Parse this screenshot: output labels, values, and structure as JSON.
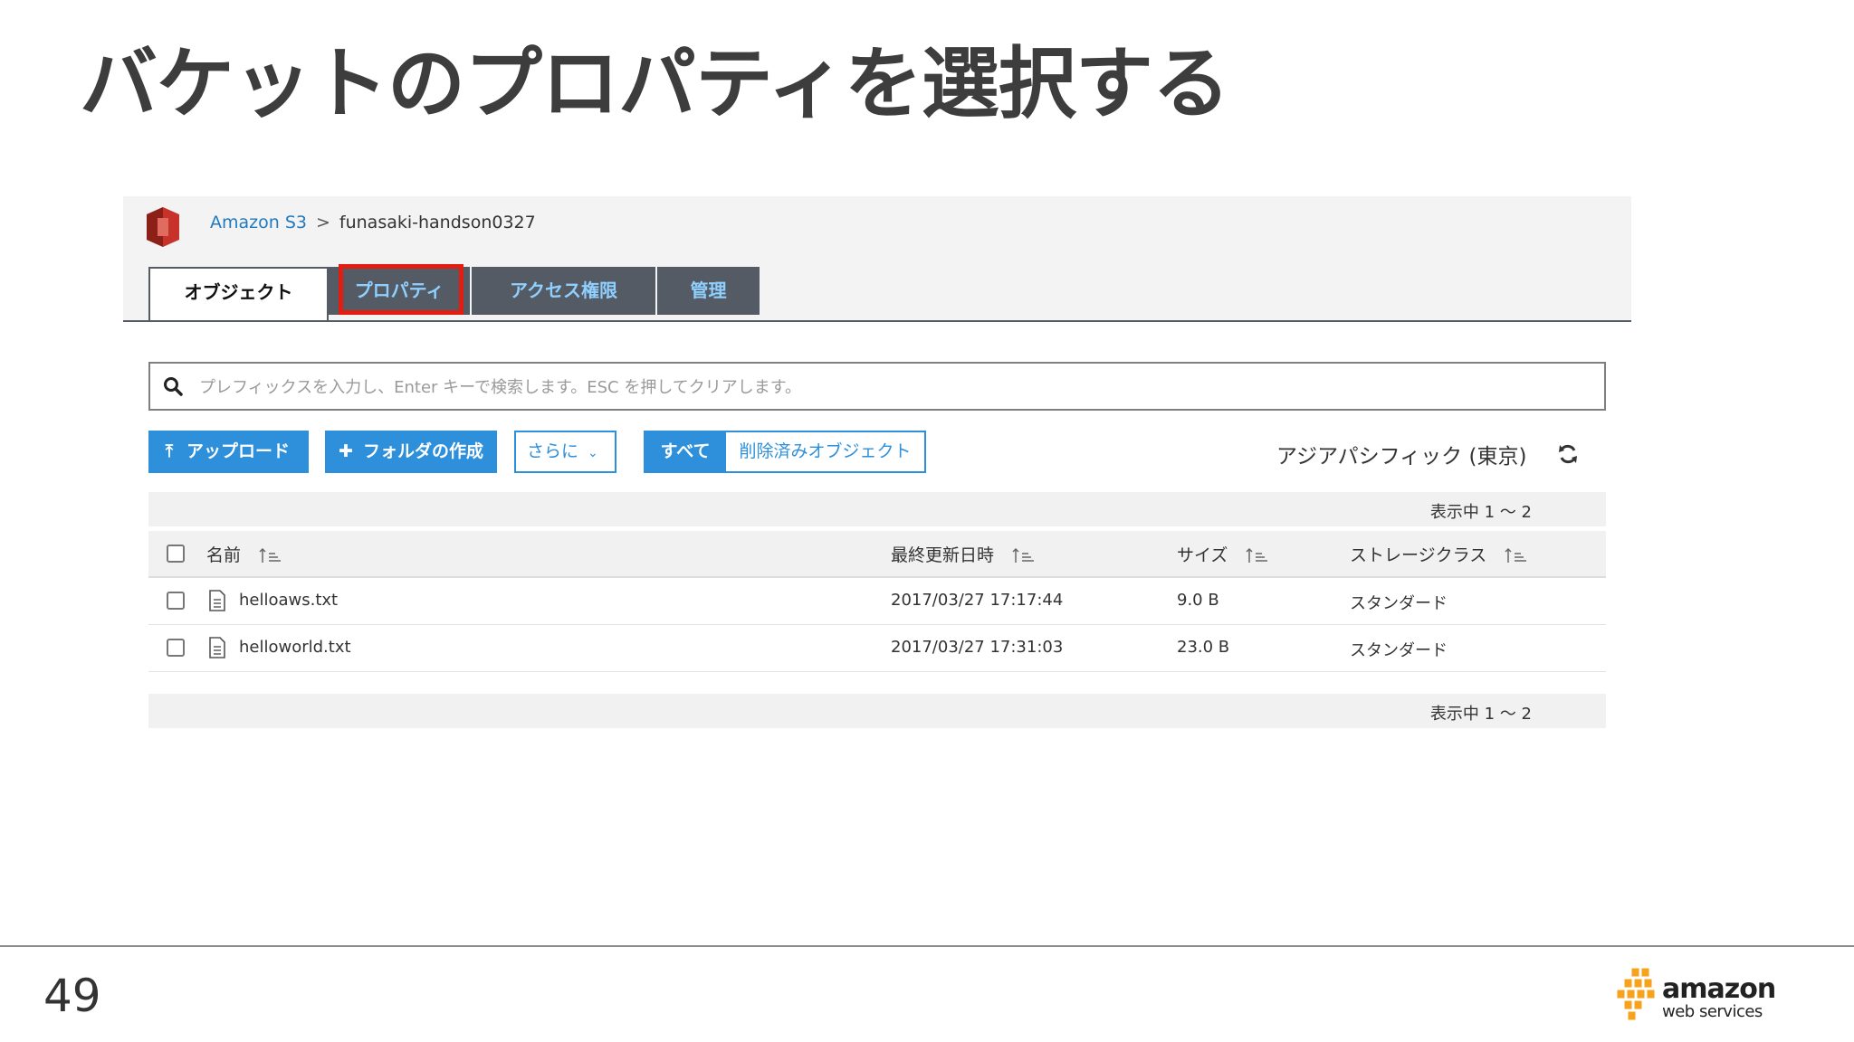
{
  "slide": {
    "title": "バケットのプロパティを選択する",
    "page_number": "49"
  },
  "console": {
    "breadcrumb": {
      "service": "Amazon S3",
      "separator": ">",
      "bucket": "funasaki-handson0327"
    },
    "tabs": [
      {
        "label": "オブジェクト",
        "active": true
      },
      {
        "label": "プロパティ",
        "active": false,
        "highlighted": true
      },
      {
        "label": "アクセス権限",
        "active": false
      },
      {
        "label": "管理",
        "active": false
      }
    ],
    "search": {
      "placeholder": "プレフィックスを入力し、Enter キーで検索します。ESC を押してクリアします。",
      "value": ""
    },
    "toolbar": {
      "upload_label": "アップロード",
      "create_folder_label": "フォルダの作成",
      "more_label": "さらに",
      "filter_all_label": "すべて",
      "filter_deleted_label": "削除済みオブジェクト",
      "region": "アジアパシフィック (東京)"
    },
    "count_text": "表示中 1 ～ 2",
    "table": {
      "headers": {
        "name": "名前",
        "modified": "最終更新日時",
        "size": "サイズ",
        "storage_class": "ストレージクラス"
      },
      "rows": [
        {
          "name": "helloaws.txt",
          "modified": "2017/03/27 17:17:44",
          "size": "9.0 B",
          "storage_class": "スタンダード"
        },
        {
          "name": "helloworld.txt",
          "modified": "2017/03/27 17:31:03",
          "size": "23.0 B",
          "storage_class": "スタンダード"
        }
      ]
    }
  },
  "brand": {
    "logo_text_1": "amazon",
    "logo_text_2": "web services"
  },
  "colors": {
    "highlight": "#e11d11",
    "primary_button": "#2e8fdb",
    "tab_bar": "#545b64",
    "aws_orange": "#f7a21b"
  }
}
